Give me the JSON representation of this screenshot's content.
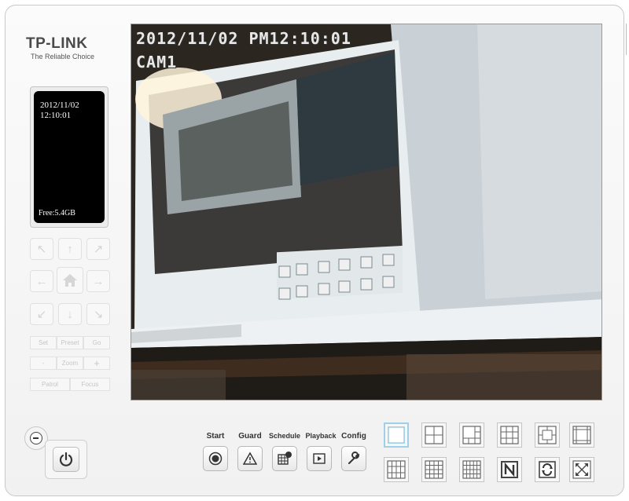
{
  "brand": {
    "name": "TP-LINK",
    "tagline": "The Reliable Choice"
  },
  "info": {
    "date": "2012/11/02",
    "time": "12:10:01",
    "free": "Free:5.4GB"
  },
  "ptz": {
    "set_label": "Set",
    "preset_label": "Preset",
    "go_label": "Go",
    "zoom_minus": "-",
    "zoom_label": "Zoom",
    "zoom_plus": "+",
    "patrol_label": "Patrol",
    "focus_label": "Focus"
  },
  "video": {
    "timestamp": "2012/11/02 PM12:10:01",
    "camera": "CAM1"
  },
  "functions": [
    {
      "label": "Start",
      "icon": "record-icon"
    },
    {
      "label": "Guard",
      "icon": "warning-icon"
    },
    {
      "label": "Schedule",
      "icon": "schedule-icon"
    },
    {
      "label": "Playback",
      "icon": "playback-icon"
    },
    {
      "label": "Config",
      "icon": "wrench-icon"
    }
  ],
  "layouts": [
    {
      "icon": "layout-1-icon",
      "active": true
    },
    {
      "icon": "layout-4-icon"
    },
    {
      "icon": "layout-6-icon"
    },
    {
      "icon": "layout-8-icon"
    },
    {
      "icon": "layout-9-icon"
    },
    {
      "icon": "layout-10-icon"
    },
    {
      "icon": "layout-13-icon"
    },
    {
      "icon": "layout-16-icon"
    },
    {
      "icon": "layout-20-icon"
    },
    {
      "icon": "layout-n-icon"
    },
    {
      "icon": "layout-rotate-icon"
    },
    {
      "icon": "fullscreen-icon"
    }
  ],
  "colors": {
    "accent": "#9fd0ea",
    "osd_text": "#e8e8e8"
  }
}
